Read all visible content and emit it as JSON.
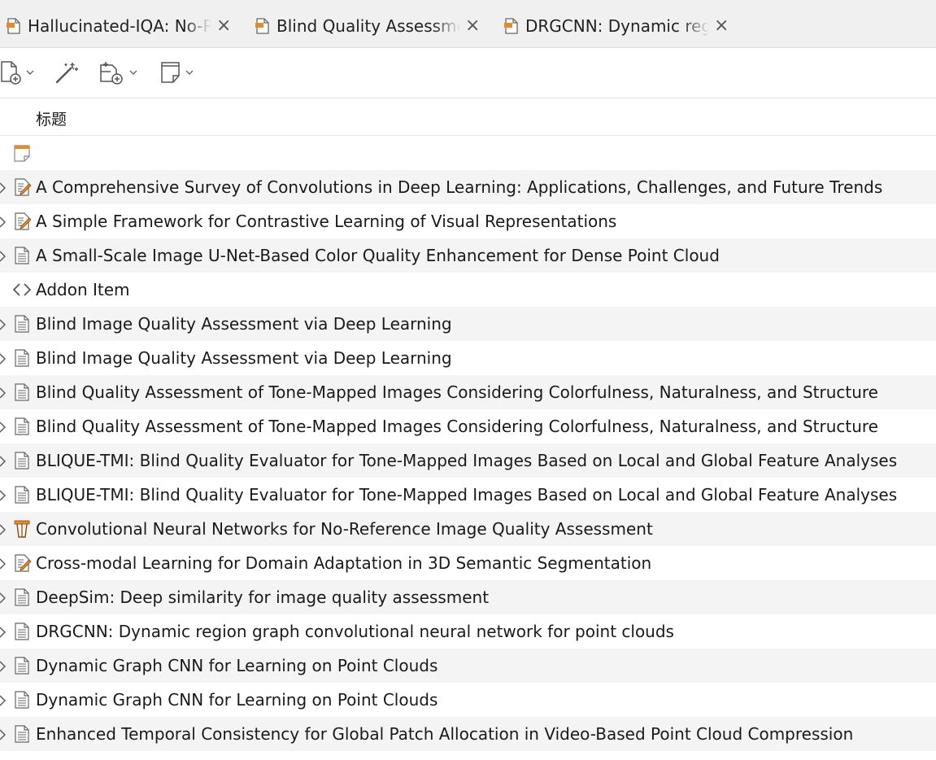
{
  "tabs": [
    {
      "label": "Hallucinated-IQA: No-Re",
      "icon": "pdf-document-icon"
    },
    {
      "label": "Blind Quality Assessmen",
      "icon": "pdf-document-icon"
    },
    {
      "label": "DRGCNN: Dynamic regio",
      "icon": "pdf-document-icon"
    }
  ],
  "toolbar": {
    "new_item": "new-item-icon",
    "magic_wand": "add-by-identifier-icon",
    "add_attachment": "add-attachment-icon",
    "new_note": "new-note-icon"
  },
  "header": {
    "title_column": "标题"
  },
  "colors": {
    "accent_orange": "#e38a2b",
    "row_alt": "#f4f4f4",
    "text": "#1a1a1a"
  },
  "rows": [
    {
      "title": "",
      "icon": "note-icon",
      "chevron": false
    },
    {
      "title": "A Comprehensive Survey of Convolutions in Deep Learning: Applications, Challenges, and Future Trends",
      "icon": "preprint-icon",
      "chevron": true
    },
    {
      "title": "A Simple Framework for Contrastive Learning of Visual Representations",
      "icon": "preprint-icon",
      "chevron": true
    },
    {
      "title": "A Small-Scale Image U-Net-Based Color Quality Enhancement for Dense Point Cloud",
      "icon": "journal-article-icon",
      "chevron": true
    },
    {
      "title": "Addon Item",
      "icon": "code-icon",
      "chevron": false
    },
    {
      "title": "Blind Image Quality Assessment via Deep Learning",
      "icon": "journal-article-icon",
      "chevron": true
    },
    {
      "title": "Blind Image Quality Assessment via Deep Learning",
      "icon": "journal-article-icon",
      "chevron": true
    },
    {
      "title": "Blind Quality Assessment of Tone-Mapped Images Considering Colorfulness, Naturalness, and Structure",
      "icon": "journal-article-icon",
      "chevron": true
    },
    {
      "title": "Blind Quality Assessment of Tone-Mapped Images Considering Colorfulness, Naturalness, and Structure",
      "icon": "journal-article-icon",
      "chevron": true
    },
    {
      "title": "BLIQUE-TMI: Blind Quality Evaluator for Tone-Mapped Images Based on Local and Global Feature Analyses",
      "icon": "journal-article-icon",
      "chevron": true
    },
    {
      "title": "BLIQUE-TMI: Blind Quality Evaluator for Tone-Mapped Images Based on Local and Global Feature Analyses",
      "icon": "journal-article-icon",
      "chevron": true
    },
    {
      "title": "Convolutional Neural Networks for No-Reference Image Quality Assessment",
      "icon": "conference-paper-icon",
      "chevron": true
    },
    {
      "title": "Cross-modal Learning for Domain Adaptation in 3D Semantic Segmentation",
      "icon": "preprint-icon",
      "chevron": true
    },
    {
      "title": "DeepSim: Deep similarity for image quality assessment",
      "icon": "journal-article-icon",
      "chevron": true
    },
    {
      "title": "DRGCNN: Dynamic region graph convolutional neural network for point clouds",
      "icon": "journal-article-icon",
      "chevron": true
    },
    {
      "title": "Dynamic Graph CNN for Learning on Point Clouds",
      "icon": "journal-article-icon",
      "chevron": true
    },
    {
      "title": "Dynamic Graph CNN for Learning on Point Clouds",
      "icon": "journal-article-icon",
      "chevron": true
    },
    {
      "title": "Enhanced Temporal Consistency for Global Patch Allocation in Video-Based Point Cloud Compression",
      "icon": "journal-article-icon",
      "chevron": true
    }
  ]
}
